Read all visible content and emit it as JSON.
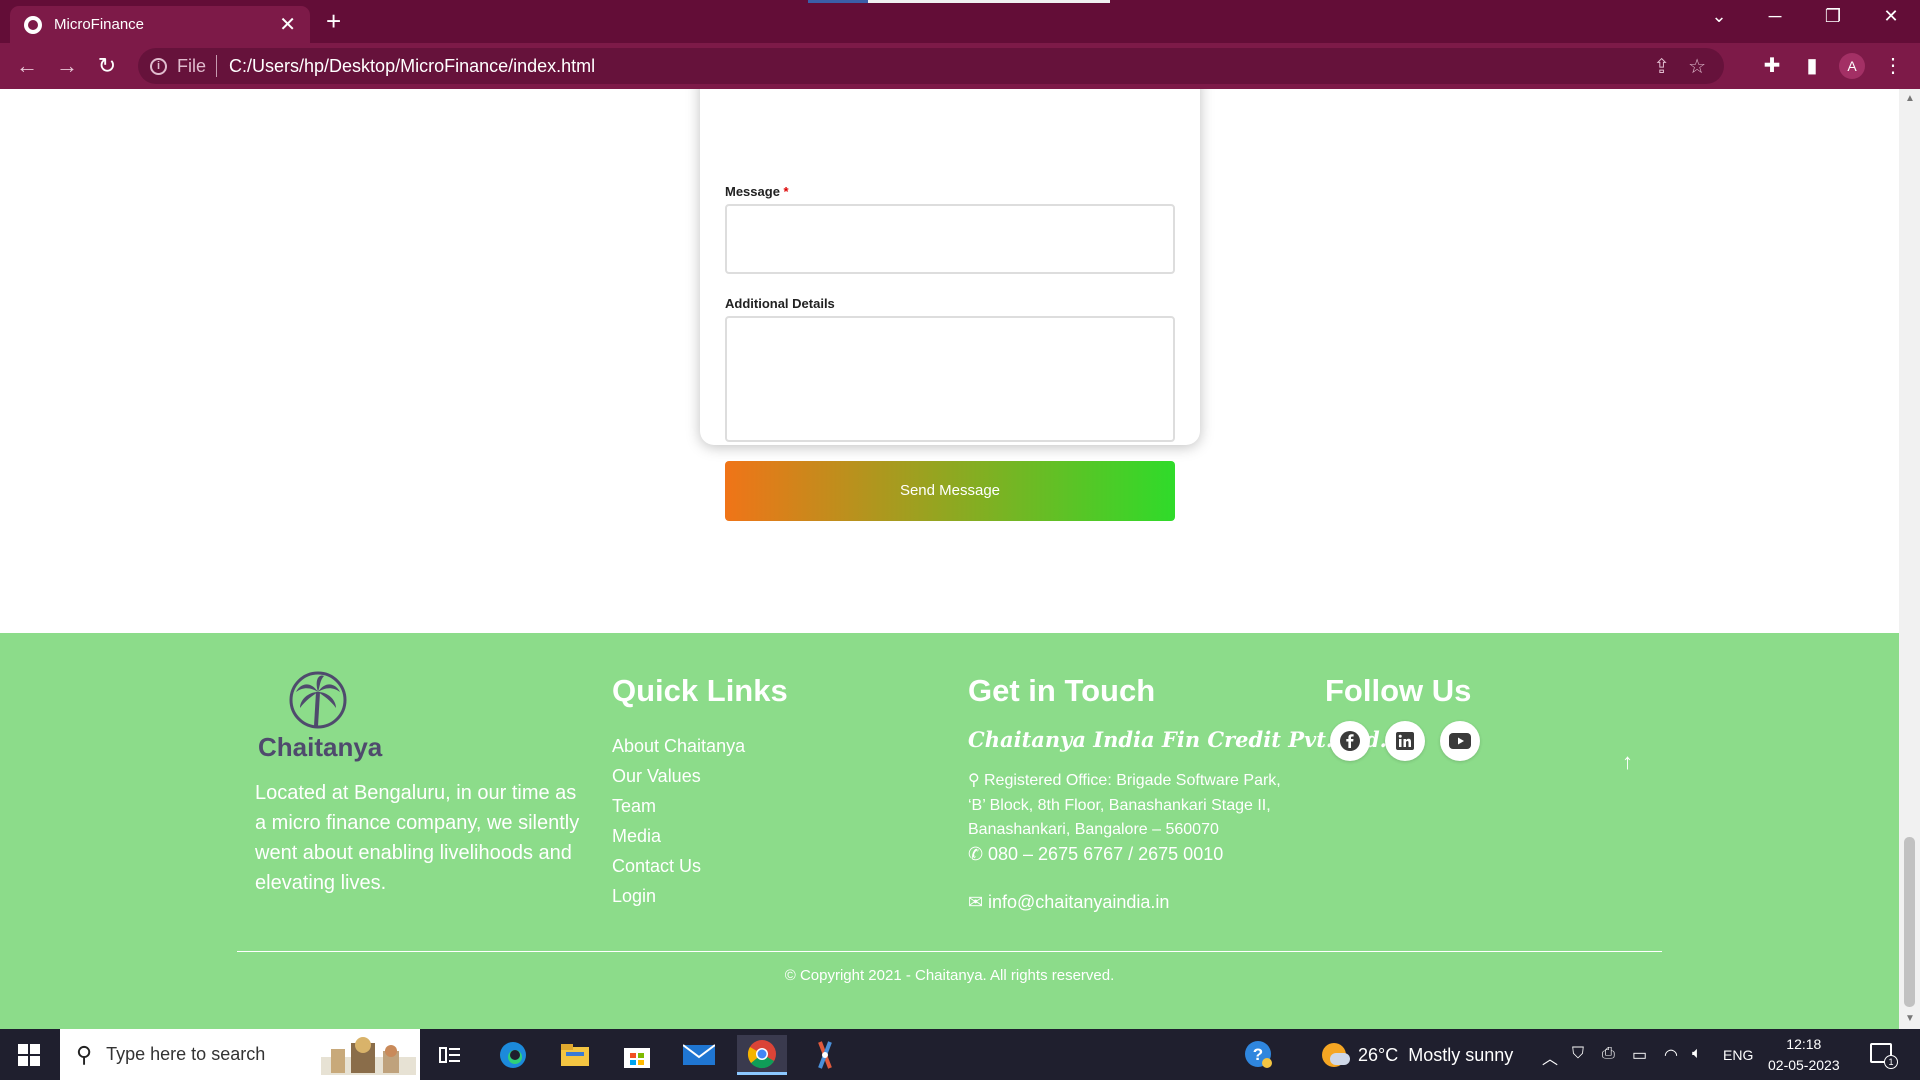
{
  "browser": {
    "tab_title": "MicroFinance",
    "tab_close": "✕",
    "new_tab": "+",
    "scheme_label": "File",
    "url": "C:/Users/hp/Desktop/MicroFinance/index.html",
    "profile_initial": "A"
  },
  "form": {
    "message_label": "Message",
    "required_mark": "*",
    "details_label": "Additional Details",
    "send_label": "Send Message",
    "send_gradient": [
      "#f07418",
      "#2fdb2a"
    ]
  },
  "footer": {
    "bg_color": "#8cdc8a",
    "logo_name": "Chaitanya",
    "about": "Located at Bengaluru, in our time as a micro finance company, we silently went about enabling livelihoods and elevating lives.",
    "quick_links_heading": "Quick Links",
    "quick_links": [
      "About Chaitanya",
      "Our Values",
      "Team",
      "Media",
      "Contact Us",
      "Login"
    ],
    "contact_heading": "Get in Touch",
    "company_name": "Chaitanya India Fin Credit Pvt. Ltd.",
    "address": "Registered Office: Brigade Software Park, ‘B’ Block, 8th Floor, Banashankari Stage II, Banashankari, Bangalore – 560070",
    "phone": "080 – 2675 6767 / 2675 0010",
    "email": "info@chaitanyaindia.in",
    "follow_heading": "Follow Us",
    "social_icons": [
      "facebook-icon",
      "linkedin-icon",
      "youtube-icon"
    ],
    "back_to_top": "↑",
    "copyright": "© Copyright 2021 - Chaitanya. All rights reserved."
  },
  "taskbar": {
    "search_placeholder": "Type here to search",
    "weather": "26°C  Mostly sunny",
    "language": "ENG",
    "time": "12:18",
    "date": "02-05-2023",
    "notification_count": "1"
  }
}
